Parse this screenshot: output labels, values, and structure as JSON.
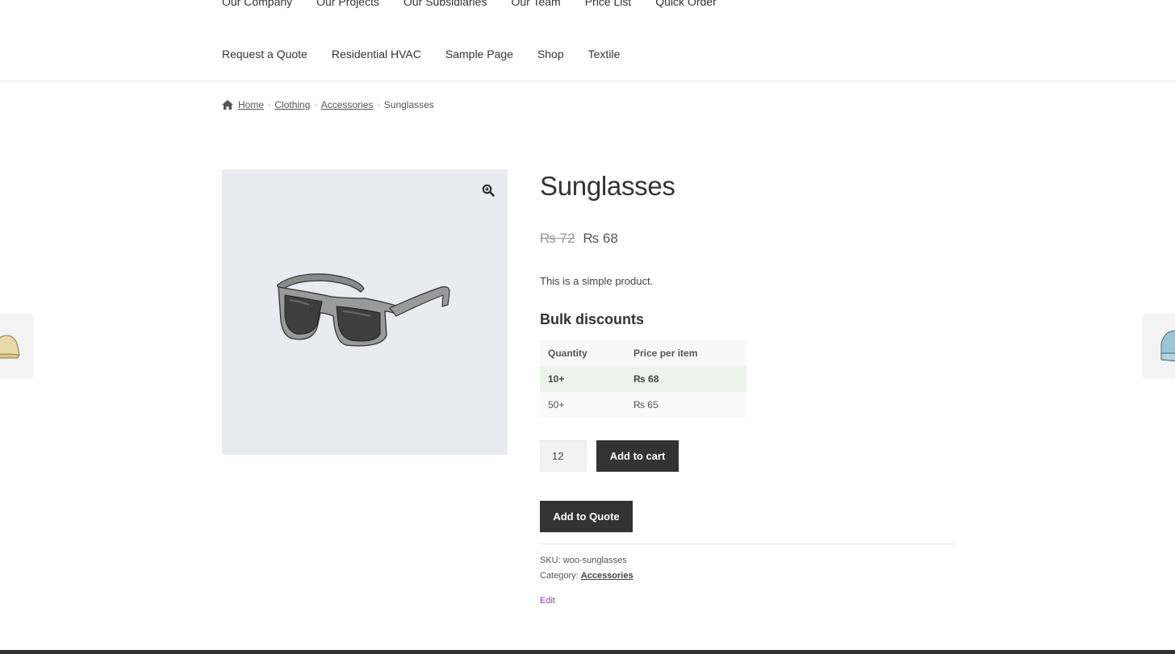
{
  "nav": {
    "row1": [
      "Our Company",
      "Our Projects",
      "Our Subsidiaries",
      "Our Team",
      "Price List",
      "Quick Order"
    ],
    "row2": [
      "Request a Quote",
      "Residential HVAC",
      "Sample Page",
      "Shop",
      "Textile"
    ]
  },
  "breadcrumb": {
    "home": "Home",
    "items": [
      "Clothing",
      "Accessories"
    ],
    "current": "Sunglasses"
  },
  "product": {
    "title": "Sunglasses",
    "price_old": "₨ 72",
    "price_new": "₨ 68",
    "description": "This is a simple product.",
    "bulk_title": "Bulk discounts",
    "bulk_headers": [
      "Quantity",
      "Price per item"
    ],
    "bulk_rows": [
      {
        "qty": "10+",
        "price": "₨ 68"
      },
      {
        "qty": "50+",
        "price": "₨ 65"
      }
    ],
    "quantity": "12",
    "add_to_cart": "Add to cart",
    "add_to_quote": "Add to Quote",
    "sku_label": "SKU:",
    "sku_value": "woo-sunglasses",
    "category_label": "Category:",
    "category_value": "Accessories",
    "edit": "Edit"
  },
  "icons": {
    "home": "home-icon",
    "zoom": "zoom-in-icon"
  },
  "colors": {
    "button_bg": "#333333",
    "image_bg": "#e9ebef",
    "edit_link": "#7c4a8a"
  }
}
